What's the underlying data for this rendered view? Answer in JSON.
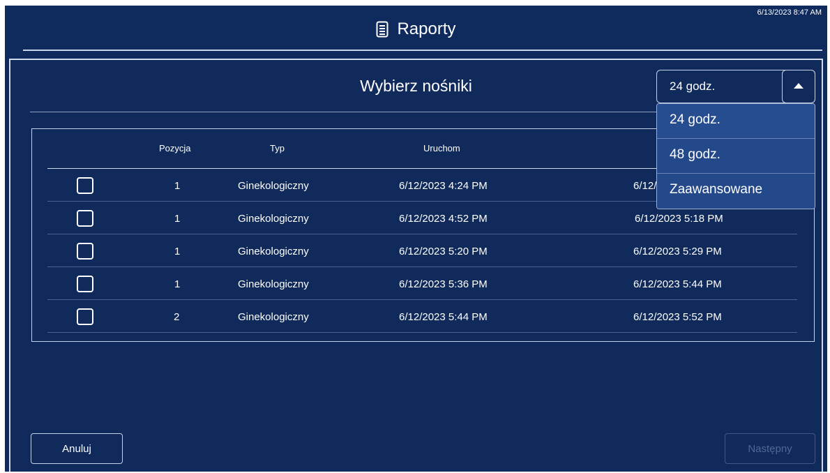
{
  "header": {
    "datetime": "6/13/2023 8:47 AM",
    "title": "Raporty",
    "title_icon": "document-icon"
  },
  "panel": {
    "title": "Wybierz nośniki"
  },
  "range_select": {
    "value": "24 godz.",
    "arrow_icon": "caret-up-icon",
    "options": [
      "24 godz.",
      "48 godz.",
      "Zaawansowane"
    ]
  },
  "table": {
    "columns": [
      "",
      "Pozycja",
      "Typ",
      "Uruchom",
      ""
    ],
    "rows": [
      {
        "position": "1",
        "type": "Ginekologiczny",
        "start": "6/12/2023 4:24 PM",
        "end": "6/12/"
      },
      {
        "position": "1",
        "type": "Ginekologiczny",
        "start": "6/12/2023 4:52 PM",
        "end": "6/12/2023 5:18 PM"
      },
      {
        "position": "1",
        "type": "Ginekologiczny",
        "start": "6/12/2023 5:20 PM",
        "end": "6/12/2023 5:29 PM"
      },
      {
        "position": "1",
        "type": "Ginekologiczny",
        "start": "6/12/2023 5:36 PM",
        "end": "6/12/2023 5:44 PM"
      },
      {
        "position": "2",
        "type": "Ginekologiczny",
        "start": "6/12/2023 5:44 PM",
        "end": "6/12/2023 5:52 PM"
      }
    ]
  },
  "buttons": {
    "cancel": "Anuluj",
    "next": "Następny"
  },
  "colors": {
    "background": "#0f2a5c",
    "menu_background": "#24498a",
    "border": "#c6d2e6",
    "disabled_text": "#4f6896"
  }
}
